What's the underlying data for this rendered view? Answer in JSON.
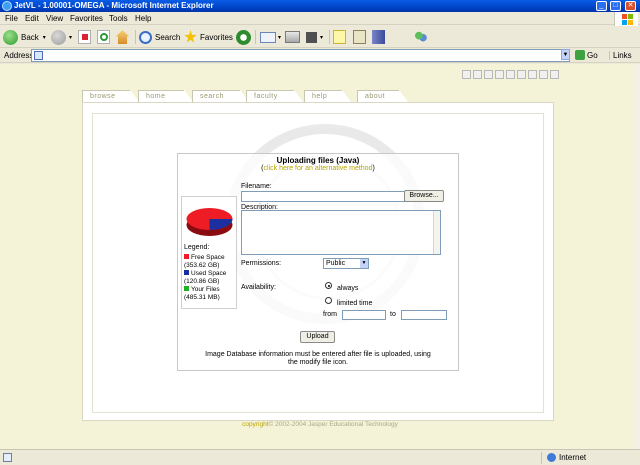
{
  "window": {
    "title": "JetVL - 1.00001-OMEGA - Microsoft Internet Explorer",
    "controls": {
      "minimize": "_",
      "maximize": "□",
      "close": "✕"
    }
  },
  "menu": [
    "File",
    "Edit",
    "View",
    "Favorites",
    "Tools",
    "Help"
  ],
  "toolbar": {
    "back": "Back",
    "search": "Search",
    "favorites": "Favorites"
  },
  "address": {
    "label": "Address",
    "value": "",
    "go": "Go",
    "links": "Links"
  },
  "site": {
    "tabs": [
      "browse",
      "home",
      "search",
      "faculty",
      "help",
      "about"
    ],
    "upload": {
      "title": "Uploading files (Java)",
      "alt_open": "(",
      "alt_link": "click here for an alternative method",
      "alt_close": ")",
      "filename_label": "Filename:",
      "browse_button": "Browse...",
      "description_label": "Description:",
      "permissions_label": "Permissions:",
      "permissions_value": "Public",
      "availability_label": "Availability:",
      "option_always": "always",
      "option_limited": "limited time",
      "from_label": "from",
      "to_label": "to",
      "upload_button": "Upload",
      "note_line1": "Image Database information must be entered after file is uploaded, using",
      "note_line2": "the modify file icon."
    },
    "legend": {
      "title": "Legend:",
      "free_label": "Free Space",
      "free_value": "(353.62 GB)",
      "used_label": "Used Space",
      "used_value": "(120.86 GB)",
      "yours_label": "Your Files",
      "yours_value": "(485.31 MB)"
    },
    "copyright_word": "copyright",
    "copyright_rest": "© 2002-2004 Jasper Educational Technology"
  },
  "colors": {
    "free": "#ee1c25",
    "used": "#1a2fa0",
    "yours": "#22b022",
    "accent": "#b8a400"
  },
  "status": {
    "left": "",
    "zone": "Internet"
  }
}
